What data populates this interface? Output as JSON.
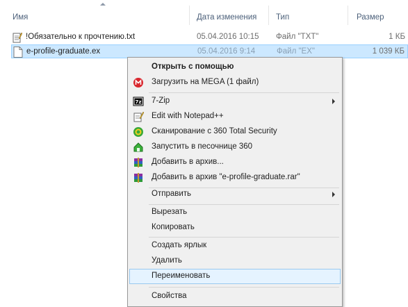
{
  "columns": {
    "name": "Имя",
    "date": "Дата изменения",
    "type": "Тип",
    "size": "Размер"
  },
  "files": [
    {
      "name": "!Обязательно к прочтению.txt",
      "date": "05.04.2016 10:15",
      "type": "Файл \"TXT\"",
      "size": "1 КБ",
      "icon": "notepad-text-icon"
    },
    {
      "name": "e-profile-graduate.ex",
      "date": "05.04.2016 9:14",
      "type": "Файл \"EX\"",
      "size": "1 039 КБ",
      "icon": "blank-file-icon",
      "selected": true
    }
  ],
  "context_menu": {
    "open_with": "Открыть с помощью",
    "mega": "Загрузить на MEGA (1 файл)",
    "sevenzip": "7-Zip",
    "notepadpp": "Edit with Notepad++",
    "scan360": "Сканирование с 360 Total Security",
    "sandbox360": "Запустить в песочнице 360",
    "add_archive": "Добавить в архив...",
    "add_archive_rar": "Добавить в архив \"e-profile-graduate.rar\"",
    "send_to": "Отправить",
    "cut": "Вырезать",
    "copy": "Копировать",
    "create_shortcut": "Создать ярлык",
    "delete": "Удалить",
    "rename": "Переименовать",
    "properties": "Свойства"
  },
  "colors": {
    "selection": "#cce8ff",
    "menu_hover": "#e5f3ff",
    "header_text": "#4c607a"
  }
}
